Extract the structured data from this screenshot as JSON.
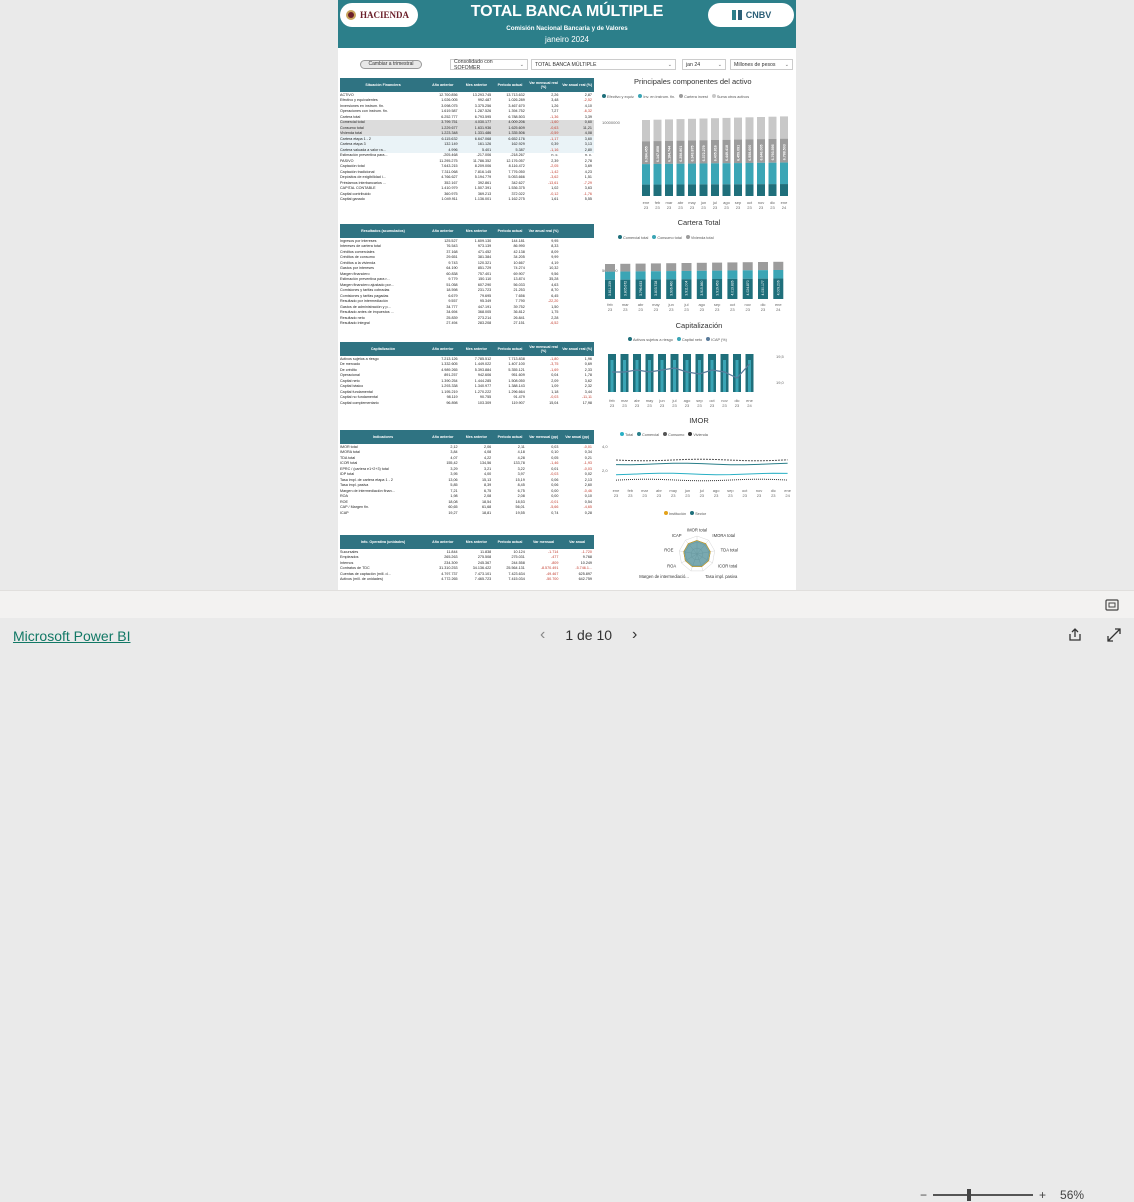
{
  "header": {
    "title": "TOTAL BANCA MÚLTIPLE",
    "subtitle": "Comisión Nacional Bancaria y de Valores",
    "period": "janeiro 2024",
    "logo_left": "HACIENDA",
    "logo_right": "CNBV"
  },
  "controls": {
    "toggle_label": "Cambiar a trimestral",
    "consolidado": "Consolidado con SOFOMER",
    "institucion": "TOTAL BANCA MÚLTIPLE",
    "mes": "jan 24",
    "unidades": "Millones de pesos"
  },
  "tables": {
    "situacion": {
      "headers": [
        "Situación Financiera",
        "Año anterior",
        "Mes anterior",
        "Periodo actual",
        "Var mensual real (%)",
        "Var anual real (%)"
      ],
      "rows": [
        [
          "ACTIVO",
          "12.700.856",
          "13.293.745",
          "13.713.632",
          "2,26",
          "2,87"
        ],
        [
          "  Efectivo y equivalentes",
          "1.026.005",
          "992.487",
          "1.026.289",
          "3,48",
          "-2,52"
        ],
        [
          "  Inversiones en instrum. fin.",
          "3.098.075",
          "3.375.256",
          "3.467.670",
          "1,26",
          "4,10"
        ],
        [
          "  Operaciones con instrum. fin.",
          "1.619.587",
          "1.287.526",
          "1.394.752",
          "7,27",
          "-6,32"
        ],
        [
          "  Cartera total",
          "6.252.777",
          "6.793.595",
          "6.788.503",
          "-1,36",
          "3,39"
        ],
        [
          "    Comercial total",
          "3.799.751",
          "4.030.177",
          "4.009.206",
          "-1,60",
          "0,60"
        ],
        [
          "    Consumo total",
          "1.229.677",
          "1.631.936",
          "1.625.609",
          "-0,63",
          "11,21"
        ],
        [
          "    Vivienda total",
          "1.223.348",
          "1.331.486",
          "1.335.506",
          "-0,59",
          "4,08"
        ],
        [
          "    Cartera etapa 1 - 2",
          "6.115.632",
          "6.647.068",
          "6.652.176",
          "-1,17",
          "3,60"
        ],
        [
          "    Cartera etapa 3",
          "132.149",
          "161.126",
          "162.929",
          "0,39",
          "3,13"
        ],
        [
          "    Cartera valuada a valor ra...",
          "4.996",
          "5.401",
          "5.387",
          "-1,16",
          "2,80"
        ],
        [
          "  Estimación preventiva para...",
          "-205.468",
          "-217.006",
          "-218.267",
          "n. c.",
          "n. c."
        ],
        [
          "PASIVO",
          "11.295.275",
          "11.786.352",
          "12.176.057",
          "2,39",
          "2,78"
        ],
        [
          "  Captación total",
          "7.643.215",
          "8.209.006",
          "8.116.472",
          "-2,05",
          "3,69"
        ],
        [
          "    Captación tradicional",
          "7.311.068",
          "7.816.145",
          "7.776.050",
          "-1,42",
          "4,23"
        ],
        [
          "      Depósitos de exigibilidad i...",
          "4.766.627",
          "5.194.779",
          "5.053.666",
          "-3,62",
          "1,51"
        ],
        [
          "      Préstamos interbancarios ...",
          "352.167",
          "392.861",
          "342.627",
          "-13,61",
          "-7,29"
        ],
        [
          "CAPITAL CONTABLE",
          "1.410.979",
          "1.507.391",
          "1.536.375",
          "1,02",
          "3,63"
        ],
        [
          "  Capital contribuido",
          "360.975",
          "369.213",
          "372.022",
          "-0,12",
          "-1,76"
        ],
        [
          "  Capital ganado",
          "1.049.911",
          "1.136.001",
          "1.162.275",
          "1,61",
          "5,55"
        ]
      ]
    },
    "resultados": {
      "headers": [
        "Resultados (acumulados)",
        "Año anterior",
        "Mes anterior",
        "Periodo actual",
        "Var anual real (%)"
      ],
      "rows": [
        [
          "  Ingresos por intereses",
          "125.527",
          "1.609.130",
          "144.181",
          "9,95"
        ],
        [
          "    Intereses de cartera total",
          "76.543",
          "973.139",
          "86.990",
          "8,33"
        ],
        [
          "      Créditos comerciales",
          "37.168",
          "471.452",
          "42.138",
          "8,09"
        ],
        [
          "      Créditos de consumo",
          "29.651",
          "381.384",
          "34.205",
          "9,99"
        ],
        [
          "      Créditos a la vivienda",
          "9.743",
          "120.321",
          "10.667",
          "4,19"
        ],
        [
          "  Gastos por intereses",
          "64.190",
          "851.729",
          "74.274",
          "10,32"
        ],
        [
          "Margen financiero",
          "60.838",
          "757.401",
          "69.907",
          "9,56"
        ],
        [
          "  Estimación preventiva para r...",
          "9.779",
          "150.110",
          "13.874",
          "35,28"
        ],
        [
          "Margen financiero ajustado por...",
          "51.058",
          "607.290",
          "56.033",
          "4,63"
        ],
        [
          "  Comisiones y tarifas cobradas",
          "18.598",
          "231.723",
          "21.253",
          "8,70"
        ],
        [
          "  Comisiones y tarifas pagadas",
          "6.679",
          "79.695",
          "7.656",
          "6,45"
        ],
        [
          "  Resultado por intermediación",
          "9.557",
          "95.349",
          "7.790",
          "-22,20"
        ],
        [
          "  Gastos de administración y p...",
          "34.777",
          "447.191",
          "39.752",
          "1,50"
        ],
        [
          "Resultado antes de impuestos ...",
          "34.694",
          "368.005",
          "36.812",
          "1,75"
        ],
        [
          "Resultado neto",
          "25.839",
          "273.214",
          "26.841",
          "2,28"
        ],
        [
          "Resultado integral",
          "27.494",
          "283.208",
          "27.151",
          "-6,52"
        ]
      ]
    },
    "capitalizacion": {
      "headers": [
        "Capitalización",
        "Año anterior",
        "Mes anterior",
        "Periodo actual",
        "Var mensual real (%)",
        "Var anual real (%)"
      ],
      "rows": [
        [
          "Activos sujetos a riesgo",
          "7.213.126",
          "7.785.512",
          "7.713.838",
          "-1,80",
          "1,96"
        ],
        [
          "  De mercado",
          "1.332.605",
          "1.449.022",
          "1.407.100",
          "-3,75",
          "0,69"
        ],
        [
          "  De crédito",
          "4.989.265",
          "5.393.884",
          "5.355.121",
          "-1,69",
          "2,33"
        ],
        [
          "  Operacional",
          "891.257",
          "942.606",
          "951.609",
          "0,04",
          "1,78"
        ],
        [
          "Capital neto",
          "1.390.254",
          "1.444.285",
          "1.508.050",
          "2,09",
          "3,62"
        ],
        [
          "  Capital básico",
          "1.293.338",
          "1.340.977",
          "1.388.143",
          "1,09",
          "2,32"
        ],
        [
          "    Capital fundamental",
          "1.195.219",
          "1.270.222",
          "1.296.664",
          "1,18",
          "3,44"
        ],
        [
          "    Capital no fundamental",
          "98.119",
          "90.755",
          "91.479",
          "-0,03",
          "-11,11"
        ],
        [
          "  Capital complementario",
          "96.898",
          "103.309",
          "119.907",
          "15,04",
          "17,98"
        ]
      ]
    },
    "indicadores": {
      "headers": [
        "Indicadores",
        "Año anterior",
        "Mes anterior",
        "Periodo actual",
        "Var mensual (pp)",
        "Var anual (pp)"
      ],
      "rows": [
        [
          "IMOR total",
          "2,12",
          "2,06",
          "2,11",
          "0,03",
          "-0,01"
        ],
        [
          "IMORA total",
          "3,84",
          "4,08",
          "4,18",
          "0,10",
          "0,34"
        ],
        [
          "TDA total",
          "4,07",
          "4,22",
          "4,28",
          "0,05",
          "0,21"
        ],
        [
          "ICOR total",
          "155,42",
          "134,56",
          "133,78",
          "-1,46",
          "-1,93"
        ],
        [
          "EPRC / (cartera e1+2+3) total",
          "3,29",
          "3,21",
          "3,22",
          "0,01",
          "-0,03"
        ],
        [
          "IDP total",
          "3,95",
          "4,00",
          "3,97",
          "-0,03",
          "0,02"
        ],
        [
          "Tasa impl. de cartera etapa 1 - 2",
          "13,06",
          "15,13",
          "15,19",
          "0,06",
          "2,13"
        ],
        [
          "Tasa impl. pasiva",
          "5,85",
          "8,39",
          "8,45",
          "0,06",
          "2,60"
        ],
        [
          "Margen de intermediación finan...",
          "7,21",
          "6,75",
          "6,75",
          "0,00",
          "-0,46"
        ],
        [
          "ROA",
          "1,98",
          "2,08",
          "2,08",
          "0,00",
          "0,10"
        ],
        [
          "ROE",
          "18,08",
          "18,54",
          "18,53",
          "-0,01",
          "0,54"
        ],
        [
          "CAP / Margen fin.",
          "60,65",
          "61,68",
          "56,01",
          "-5,66",
          "-4,65"
        ],
        [
          "ICAP",
          "19,27",
          "18,81",
          "19,55",
          "0,74",
          "0,28"
        ]
      ]
    },
    "operativa": {
      "headers": [
        "Info. Operativa (unidades)",
        "Año anterior",
        "Mes anterior",
        "Periodo actual",
        "Var mensual",
        "Var anual"
      ],
      "rows": [
        [
          "Sucursales",
          "11.844",
          "11.838",
          "10.124",
          "-1.714",
          "-1.720"
        ],
        [
          "Empleados",
          "265.263",
          "275.508",
          "275.031",
          "-477",
          "9.768"
        ],
        [
          "  Internos",
          "234.309",
          "245.367",
          "244.558",
          "-809",
          "10.249"
        ],
        [
          "Contratos de TDC",
          "31.310.253",
          "34.136.422",
          "25.564.131",
          "-8.570.491",
          "-5.746.1..."
        ],
        [
          "Cuentas de captación (mill. d...",
          "4.797.737",
          "7.473.101",
          "7.423.634",
          "-49.467",
          "625.897"
        ],
        [
          "  Activos (mill. de unidades)",
          "4.772.265",
          "7.465.723",
          "7.415.034",
          "-50.700",
          "642.759"
        ]
      ]
    }
  },
  "charts": {
    "componentes": {
      "title": "Principales componentes del activo",
      "legend": [
        "Efectivo y equiv.",
        "Inv. en instrum. fin.",
        "Cartera invest",
        "Suma otros activos"
      ],
      "colors": [
        "#1f6f7b",
        "#3ba5b5",
        "#9c9c9c",
        "#c8c8c8"
      ],
      "months": [
        "ene",
        "feb",
        "mar",
        "abr",
        "may",
        "jun",
        "jul",
        "ago",
        "sep",
        "oct",
        "nov",
        "dic",
        "ene"
      ],
      "years": [
        "23",
        "23",
        "23",
        "23",
        "23",
        "23",
        "23",
        "23",
        "23",
        "23",
        "23",
        "23",
        "24"
      ],
      "ytick": "10000000",
      "labels": [
        "6.084.455",
        "6.147.858",
        "6.184.744",
        "6.258.801",
        "6.343.875",
        "6.372.279",
        "6.405.816",
        "6.449.418",
        "6.459.091",
        "6.558.600",
        "6.646.005",
        "6.793.595",
        "6.788.503"
      ]
    },
    "cartera": {
      "title": "Cartera Total",
      "legend": [
        "Comercial total",
        "Consumo total",
        "Vivienda total"
      ],
      "colors": [
        "#1f6f7b",
        "#3ba5b5",
        "#9c9c9c"
      ],
      "months": [
        "feb",
        "mar",
        "abr",
        "may",
        "jun",
        "jul",
        "ago",
        "sep",
        "oct",
        "nov",
        "dic",
        "ene"
      ],
      "years": [
        "23",
        "23",
        "23",
        "23",
        "23",
        "23",
        "23",
        "23",
        "23",
        "23",
        "23",
        "24"
      ],
      "ytick": "5000000",
      "labels": [
        "3.811.239",
        "3.805.672",
        "3.796.633",
        "3.803.728",
        "3.906.460",
        "3.911.004",
        "3.915.860",
        "3.919.453",
        "4.013.826",
        "4.024.870",
        "4.030.177",
        "4.009.206"
      ]
    },
    "capitalizacion": {
      "title": "Capitalización",
      "legend": [
        "Activos sujetos a riesgo",
        "Capital neto",
        "ICAP (%)"
      ],
      "colors": [
        "#1f6f7b",
        "#3ba5b5",
        "#5a7b9a"
      ],
      "months": [
        "feb",
        "mar",
        "abr",
        "may",
        "jun",
        "jul",
        "ago",
        "sep",
        "oct",
        "nov",
        "dic",
        "ene"
      ],
      "years": [
        "23",
        "23",
        "23",
        "23",
        "23",
        "23",
        "23",
        "23",
        "23",
        "23",
        "23",
        "24"
      ],
      "yticks": [
        "19,5",
        "19,0"
      ],
      "icap": [
        19.1,
        19.1,
        19.2,
        19.1,
        19.2,
        19.3,
        19.1,
        19.0,
        19.2,
        19.1,
        18.8,
        19.5
      ]
    },
    "imor": {
      "title": "IMOR",
      "legend": [
        "Total",
        "Comercial",
        "Consumo",
        "Vivienda"
      ],
      "colors": [
        "#2ab0c5",
        "#2a7f8a",
        "#555555",
        "#333333"
      ],
      "months": [
        "ene",
        "feb",
        "mar",
        "abr",
        "may",
        "jun",
        "jul",
        "ago",
        "sep",
        "oct",
        "nov",
        "dic",
        "ene"
      ],
      "years": [
        "23",
        "23",
        "23",
        "23",
        "23",
        "23",
        "23",
        "23",
        "23",
        "23",
        "23",
        "23",
        "24"
      ],
      "yticks": [
        "4,0",
        "2,0"
      ]
    },
    "radar": {
      "legend": [
        "Institución",
        "Sector"
      ],
      "colors": [
        "#e3a21a",
        "#1f6f7b"
      ],
      "axes": [
        "IMOR total",
        "IMORA total",
        "TDA total",
        "ICOR total",
        "Tasa impl. pasiva",
        "Margen de intermediació...",
        "ROA",
        "ROE",
        "ICAP"
      ]
    }
  },
  "footer": {
    "zoom": "56%",
    "brand": "Microsoft Power BI",
    "page": "1 de 10"
  }
}
